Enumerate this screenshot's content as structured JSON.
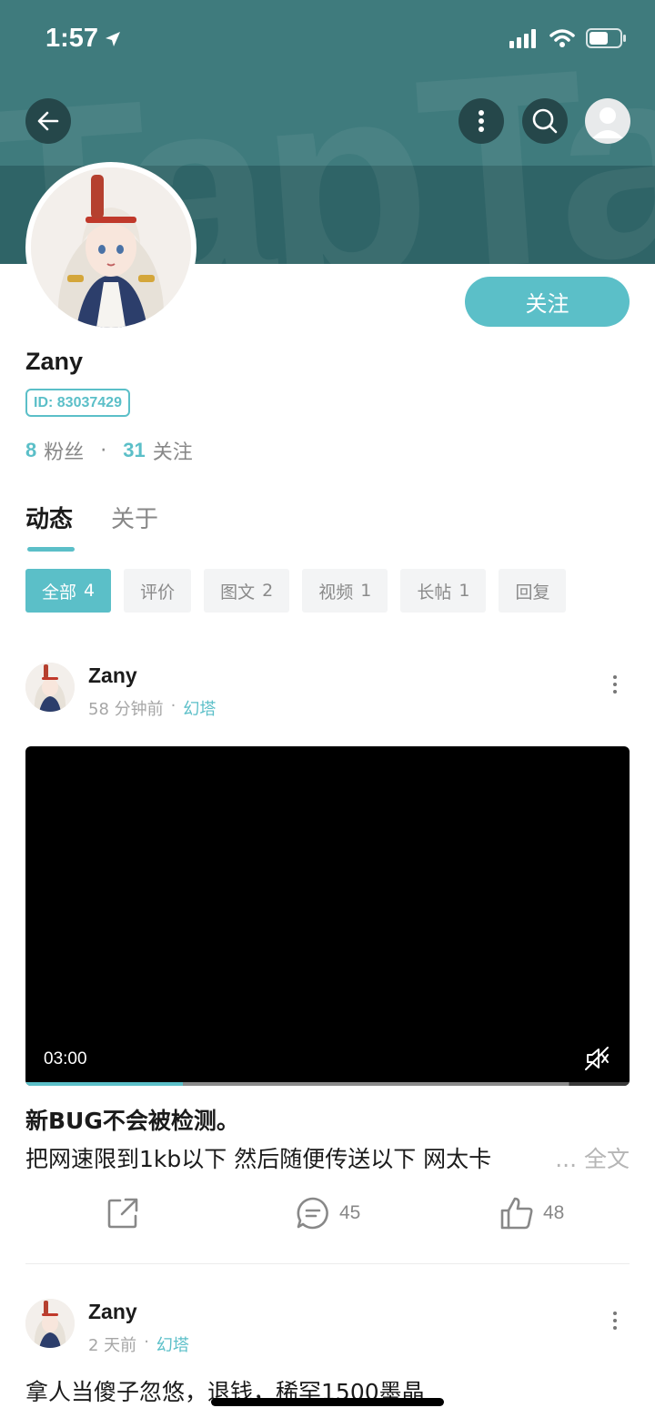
{
  "status_bar": {
    "time": "1:57"
  },
  "header": {
    "watermark": "TapTap"
  },
  "profile": {
    "follow_label": "关注",
    "name": "Zany",
    "id_label": "ID: 83037429",
    "fans_count": "8",
    "fans_label": "粉丝",
    "separator": "·",
    "following_count": "31",
    "following_label": "关注"
  },
  "tabs": [
    {
      "label": "动态",
      "active": true
    },
    {
      "label": "关于",
      "active": false
    }
  ],
  "filters": [
    {
      "label": "全部",
      "count": "4",
      "active": true
    },
    {
      "label": "评价",
      "count": "",
      "active": false
    },
    {
      "label": "图文",
      "count": "2",
      "active": false
    },
    {
      "label": "视频",
      "count": "1",
      "active": false
    },
    {
      "label": "长帖",
      "count": "1",
      "active": false
    },
    {
      "label": "回复",
      "count": "",
      "active": false
    }
  ],
  "posts": [
    {
      "author": "Zany",
      "time": "58 分钟前",
      "dot": "·",
      "game": "幻塔",
      "video": {
        "duration": "03:00",
        "progress": 0.26,
        "buffered": 0.9
      },
      "title": "新BUG不会被检测。",
      "body": "把网速限到1kb以下 然后随便传送以下 网太卡",
      "read_more": "... 全文",
      "comments": "45",
      "likes": "48"
    },
    {
      "author": "Zany",
      "time": "2 天前",
      "dot": "·",
      "game": "幻塔",
      "body": "拿人当傻子忽悠，退钱，稀罕1500墨晶"
    }
  ],
  "colors": {
    "accent": "#5bbfc8",
    "header_dark": "#2f6467",
    "header_band": "#3f7b7d"
  }
}
